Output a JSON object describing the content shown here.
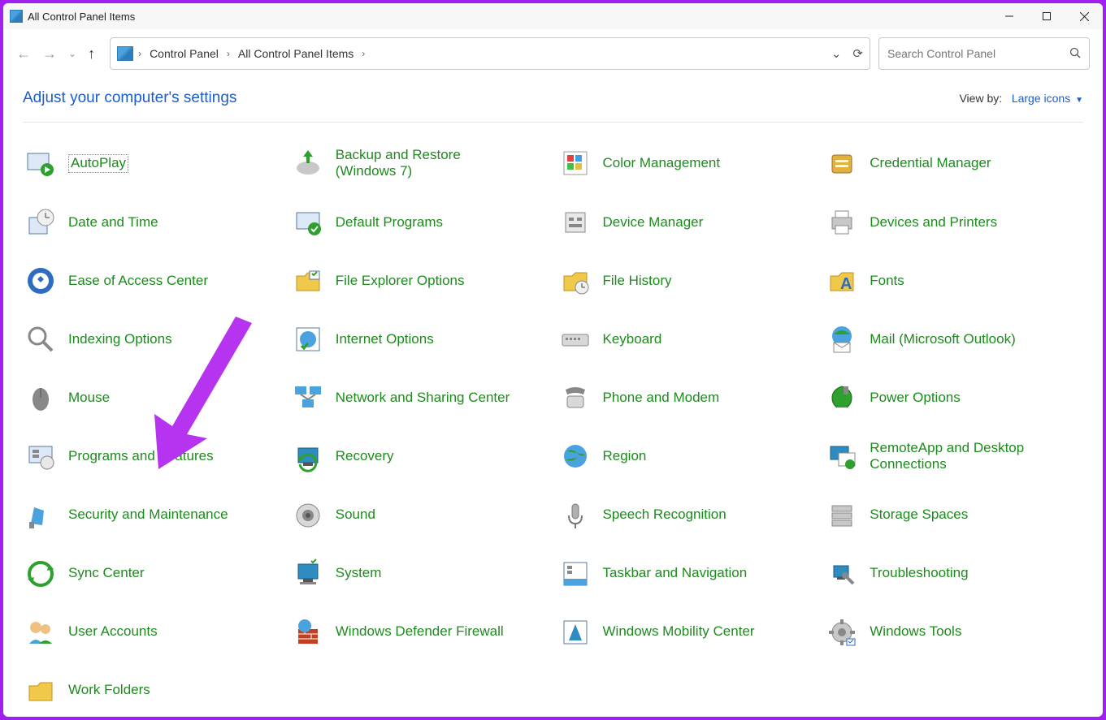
{
  "window": {
    "title": "All Control Panel Items"
  },
  "breadcrumb": {
    "root": "Control Panel",
    "current": "All Control Panel Items"
  },
  "search": {
    "placeholder": "Search Control Panel"
  },
  "header": {
    "heading": "Adjust your computer's settings",
    "viewby_label": "View by:",
    "viewby_value": "Large icons"
  },
  "items": [
    {
      "label": "AutoPlay",
      "icon": "autoplay",
      "selected": true
    },
    {
      "label": "Backup and Restore (Windows 7)",
      "icon": "backup"
    },
    {
      "label": "Color Management",
      "icon": "color"
    },
    {
      "label": "Credential Manager",
      "icon": "credential"
    },
    {
      "label": "Date and Time",
      "icon": "datetime"
    },
    {
      "label": "Default Programs",
      "icon": "default"
    },
    {
      "label": "Device Manager",
      "icon": "device"
    },
    {
      "label": "Devices and Printers",
      "icon": "printer"
    },
    {
      "label": "Ease of Access Center",
      "icon": "ease"
    },
    {
      "label": "File Explorer Options",
      "icon": "folder"
    },
    {
      "label": "File History",
      "icon": "filehistory"
    },
    {
      "label": "Fonts",
      "icon": "fonts"
    },
    {
      "label": "Indexing Options",
      "icon": "indexing"
    },
    {
      "label": "Internet Options",
      "icon": "internet"
    },
    {
      "label": "Keyboard",
      "icon": "keyboard"
    },
    {
      "label": "Mail (Microsoft Outlook)",
      "icon": "mail"
    },
    {
      "label": "Mouse",
      "icon": "mouse"
    },
    {
      "label": "Network and Sharing Center",
      "icon": "network"
    },
    {
      "label": "Phone and Modem",
      "icon": "phone"
    },
    {
      "label": "Power Options",
      "icon": "power"
    },
    {
      "label": "Programs and Features",
      "icon": "programs"
    },
    {
      "label": "Recovery",
      "icon": "recovery"
    },
    {
      "label": "Region",
      "icon": "region"
    },
    {
      "label": "RemoteApp and Desktop Connections",
      "icon": "remote"
    },
    {
      "label": "Security and Maintenance",
      "icon": "security"
    },
    {
      "label": "Sound",
      "icon": "sound"
    },
    {
      "label": "Speech Recognition",
      "icon": "speech"
    },
    {
      "label": "Storage Spaces",
      "icon": "storage"
    },
    {
      "label": "Sync Center",
      "icon": "sync"
    },
    {
      "label": "System",
      "icon": "system"
    },
    {
      "label": "Taskbar and Navigation",
      "icon": "taskbar"
    },
    {
      "label": "Troubleshooting",
      "icon": "troubleshoot"
    },
    {
      "label": "User Accounts",
      "icon": "users"
    },
    {
      "label": "Windows Defender Firewall",
      "icon": "firewall"
    },
    {
      "label": "Windows Mobility Center",
      "icon": "mobility"
    },
    {
      "label": "Windows Tools",
      "icon": "tools"
    },
    {
      "label": "Work Folders",
      "icon": "workfolders"
    }
  ]
}
